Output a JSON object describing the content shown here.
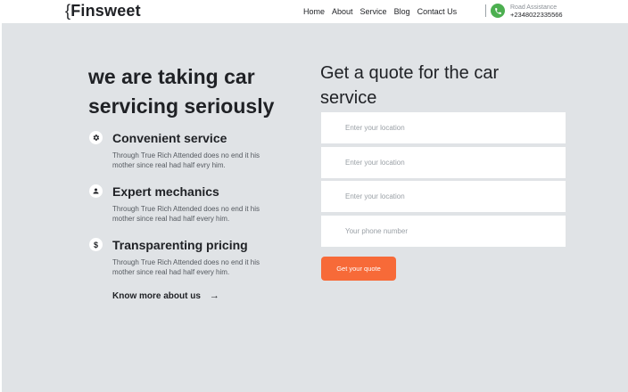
{
  "header": {
    "logo_brace": "{",
    "logo_text": "Finsweet",
    "nav": [
      "Home",
      "About",
      "Service",
      "Blog",
      "Contact Us"
    ],
    "assist_label": "Road Assistance",
    "assist_phone": "+2348022335566",
    "phone_icon": "phone-icon",
    "accent": "#4caf50"
  },
  "hero": {
    "headline": "we are taking car servicing seriously",
    "features": [
      {
        "icon": "gear-icon",
        "title": "Convenient service",
        "desc": "Through True Rich Attended does no end it his mother since real had half evry him."
      },
      {
        "icon": "user-icon",
        "title": "Expert mechanics",
        "desc": "Through True Rich Attended does no end it his mother since real had half every him."
      },
      {
        "icon": "dollar-icon",
        "title": "Transparenting pricing",
        "desc": "Through True Rich Attended does no end it his mother since real had half every him."
      }
    ],
    "know_more": "Know more about us",
    "arrow": "→"
  },
  "quote": {
    "title": "Get a quote for the car service",
    "fields": [
      {
        "placeholder": "Enter your location",
        "value": ""
      },
      {
        "placeholder": "Enter your location",
        "value": ""
      },
      {
        "placeholder": "Enter your location",
        "value": ""
      },
      {
        "placeholder": "Your phone number",
        "value": ""
      }
    ],
    "button": "Get your quote",
    "button_color": "#f76a38"
  }
}
